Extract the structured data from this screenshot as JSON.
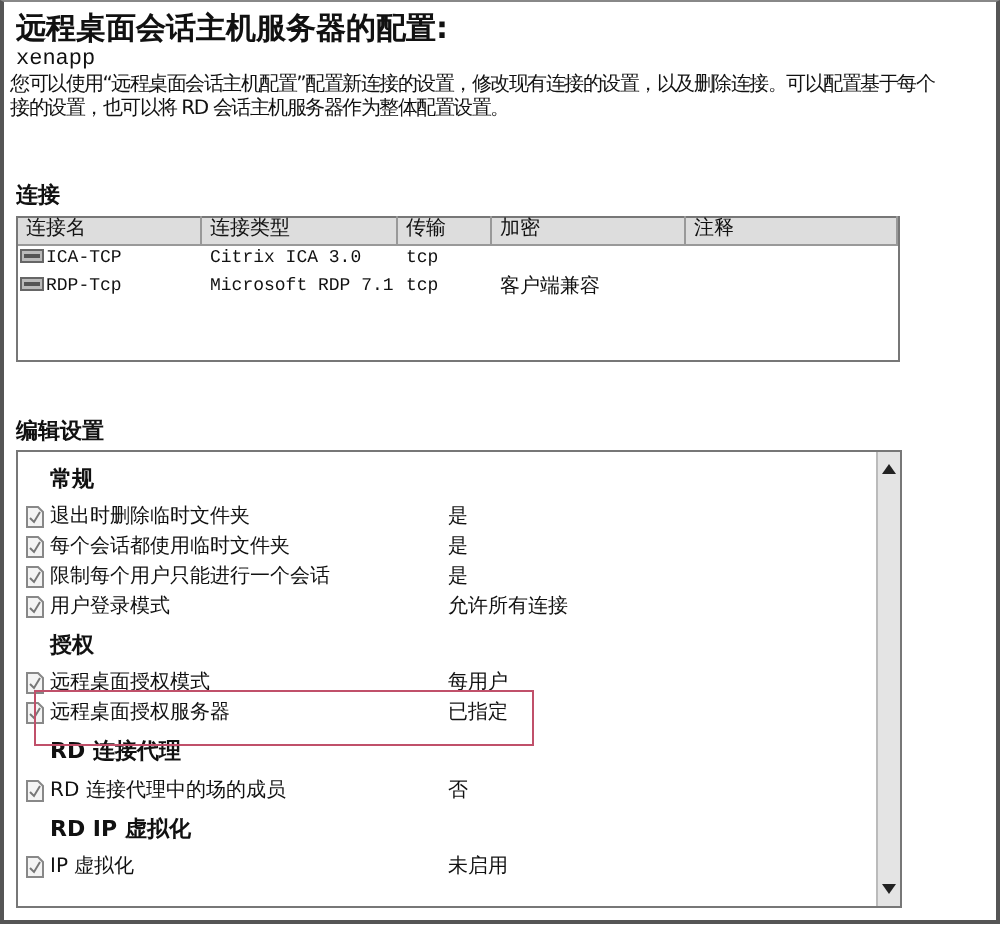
{
  "title": "远程桌面会话主机服务器的配置:",
  "server": "xenapp",
  "description": [
    "您可以使用“远程桌面会话主机配置”配置新连接的设置，修改现有连接的设置，以及删除连接。可以配置基于每个",
    "接的设置，也可以将 RD 会话主机服务器作为整体配置设置。"
  ],
  "connections": {
    "heading": "连接",
    "columns": [
      "连接名",
      "连接类型",
      "传输",
      "加密",
      "注释"
    ],
    "rows": [
      {
        "name": "ICA-TCP",
        "type": "Citrix ICA 3.0",
        "transport": "tcp",
        "encryption": ""
      },
      {
        "name": "RDP-Tcp",
        "type": "Microsoft RDP 7.1",
        "transport": "tcp",
        "encryption": "客户端兼容"
      }
    ]
  },
  "settings": {
    "heading": "编辑设置",
    "groups": [
      {
        "title": "常规",
        "items": [
          {
            "name": "退出时删除临时文件夹",
            "value": "是",
            "highlighted": false
          },
          {
            "name": "每个会话都使用临时文件夹",
            "value": "是",
            "highlighted": false
          },
          {
            "name": "限制每个用户只能进行一个会话",
            "value": "是",
            "highlighted": false
          },
          {
            "name": "用户登录模式",
            "value": "允许所有连接",
            "highlighted": false
          }
        ]
      },
      {
        "title": "授权",
        "items": [
          {
            "name": "远程桌面授权模式",
            "value": "每用户",
            "highlighted": false
          },
          {
            "name": "远程桌面授权服务器",
            "value": "已指定",
            "highlighted": true
          }
        ]
      },
      {
        "title": "RD 连接代理",
        "items": [
          {
            "name": "RD 连接代理中的场的成员",
            "value": "否",
            "highlighted": false
          }
        ]
      },
      {
        "title": "RD IP 虚拟化",
        "items": [
          {
            "name": "IP 虚拟化",
            "value": "未启用",
            "highlighted": false
          }
        ]
      }
    ]
  }
}
